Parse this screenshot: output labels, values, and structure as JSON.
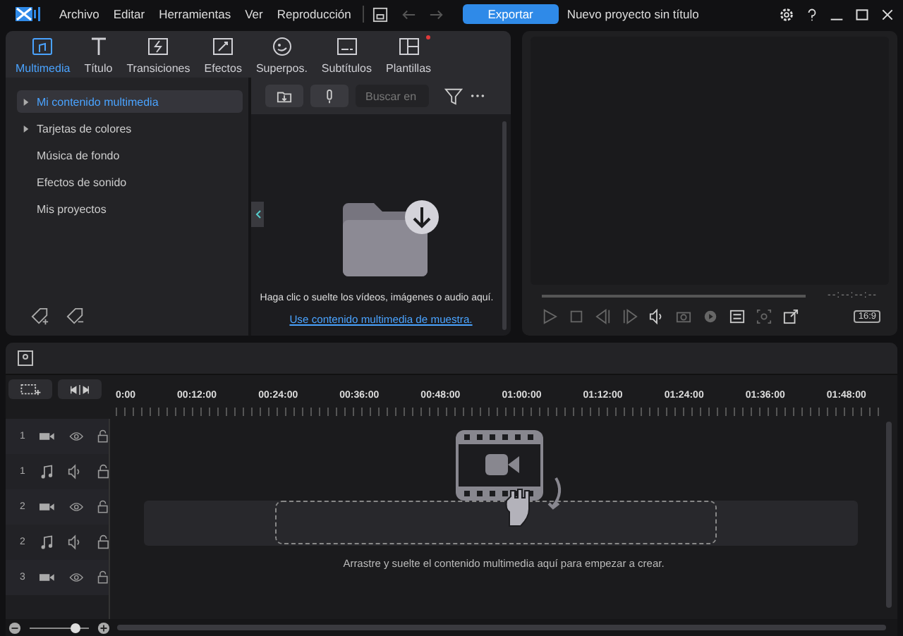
{
  "menu": [
    "Archivo",
    "Editar",
    "Herramientas",
    "Ver",
    "Reproducción"
  ],
  "export_button": "Exportar",
  "project_title": "Nuevo proyecto sin título",
  "tabs": [
    {
      "label": "Multimedia",
      "kind": "media",
      "selected": true
    },
    {
      "label": "Título",
      "kind": "title",
      "selected": false
    },
    {
      "label": "Transiciones",
      "kind": "transition",
      "selected": false
    },
    {
      "label": "Efectos",
      "kind": "effect",
      "selected": false
    },
    {
      "label": "Superpos.",
      "kind": "overlay",
      "selected": false
    },
    {
      "label": "Subtítulos",
      "kind": "subtitle",
      "selected": false
    },
    {
      "label": "Plantillas",
      "kind": "template",
      "selected": false,
      "badge": true
    }
  ],
  "sidebar": {
    "items": [
      {
        "label": "Mi contenido multimedia",
        "expandable": true,
        "selected": true
      },
      {
        "label": "Tarjetas de colores",
        "expandable": true,
        "selected": false
      },
      {
        "label": "Música de fondo",
        "expandable": false,
        "selected": false
      },
      {
        "label": "Efectos de sonido",
        "expandable": false,
        "selected": false
      },
      {
        "label": "Mis proyectos",
        "expandable": false,
        "selected": false
      }
    ]
  },
  "media": {
    "search": {
      "placeholder": "Buscar en"
    },
    "drop_text": "Haga clic o suelte los vídeos, imágenes o audio aquí.",
    "sample_link": "Use contenido multimedia de muestra."
  },
  "preview": {
    "timecode": "--:--:--:--",
    "aspect": "16:9"
  },
  "timeline": {
    "ruler": [
      "0:00",
      "00:12:00",
      "00:24:00",
      "00:36:00",
      "00:48:00",
      "01:00:00",
      "01:12:00",
      "01:24:00",
      "01:36:00",
      "01:48:00"
    ],
    "tracks": [
      {
        "number": "1",
        "kind": "video"
      },
      {
        "number": "1",
        "kind": "audio"
      },
      {
        "number": "2",
        "kind": "video"
      },
      {
        "number": "2",
        "kind": "audio"
      },
      {
        "number": "3",
        "kind": "video"
      }
    ],
    "drop_hint": "Arrastre y suelte el contenido multimedia aquí para empezar a crear.",
    "zoom": {
      "level": 0.75
    }
  }
}
